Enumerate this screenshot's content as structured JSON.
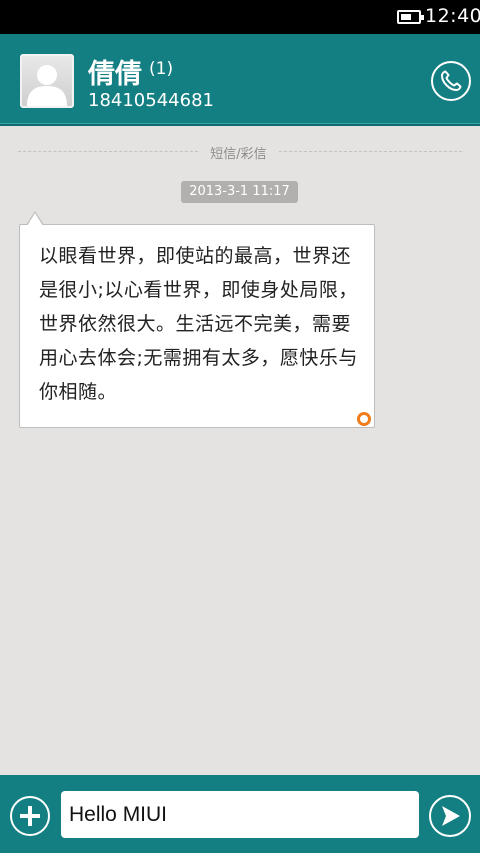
{
  "status_bar": {
    "time": "12:40"
  },
  "header": {
    "contact_name": "倩倩",
    "unread_count": "(1)",
    "phone_number": "18410544681"
  },
  "thread": {
    "divider_label": "短信/彩信",
    "messages": [
      {
        "timestamp": "2013-3-1 11:17",
        "text": "以眼看世界，即使站的最高，世界还是很小;以心看世界，即使身处局限，世界依然很大。生活远不完美，需要用心去体会;无需拥有太多，愿快乐与你相随。"
      }
    ]
  },
  "composer": {
    "input_value": "Hello MIUI"
  },
  "icons": {
    "battery": "battery-icon",
    "avatar": "person-avatar-icon",
    "call": "phone-icon",
    "attach": "plus-icon",
    "send": "send-arrow-icon"
  },
  "colors": {
    "accent": "#137f83",
    "background": "#e4e3e1",
    "status_dot": "#f07c1d"
  }
}
